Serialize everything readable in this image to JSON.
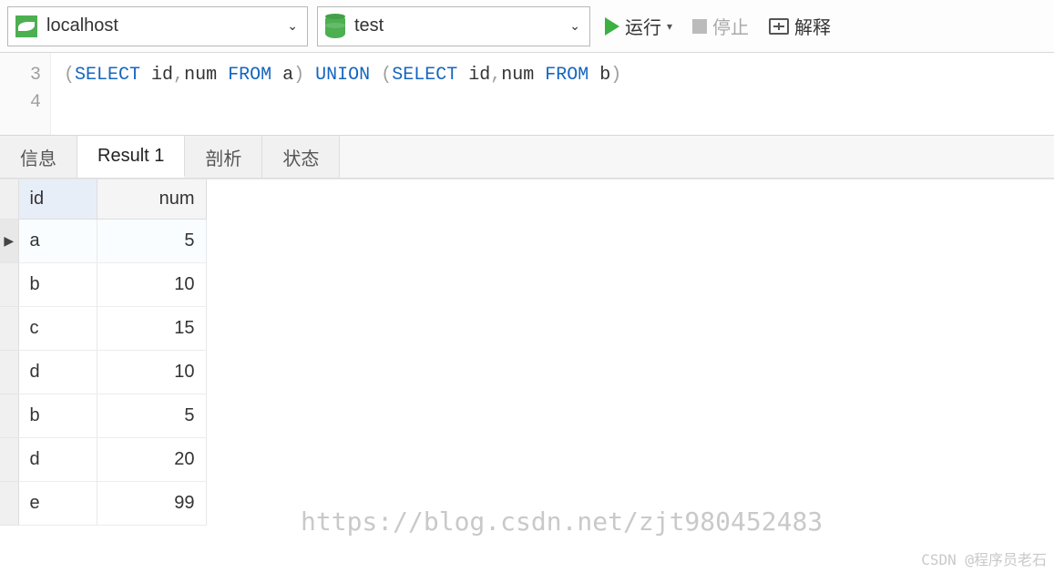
{
  "toolbar": {
    "connection": "localhost",
    "database": "test",
    "run_label": "运行",
    "stop_label": "停止",
    "explain_label": "解释"
  },
  "editor": {
    "lines": [
      "3",
      "4"
    ],
    "sql_parts": {
      "p1": "(",
      "kw1": "SELECT",
      "sp1": " id",
      "c1": ",",
      "sp2": "num ",
      "kw2": "FROM",
      "sp3": " a",
      "p2": ")",
      "sp4": " ",
      "kw3": "UNION",
      "sp5": " ",
      "p3": "(",
      "kw4": "SELECT",
      "sp6": " id",
      "c2": ",",
      "sp7": "num ",
      "kw5": "FROM",
      "sp8": " b",
      "p4": ")"
    }
  },
  "tabs": [
    "信息",
    "Result 1",
    "剖析",
    "状态"
  ],
  "active_tab": 1,
  "results": {
    "columns": [
      "id",
      "num"
    ],
    "rows": [
      {
        "id": "a",
        "num": 5
      },
      {
        "id": "b",
        "num": 10
      },
      {
        "id": "c",
        "num": 15
      },
      {
        "id": "d",
        "num": 10
      },
      {
        "id": "b",
        "num": 5
      },
      {
        "id": "d",
        "num": 20
      },
      {
        "id": "e",
        "num": 99
      }
    ],
    "selected_row": 0
  },
  "watermark": {
    "url": "https://blog.csdn.net/zjt980452483",
    "author": "CSDN @程序员老石"
  }
}
